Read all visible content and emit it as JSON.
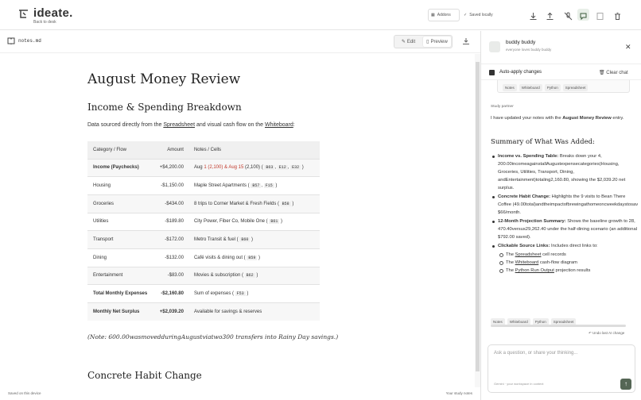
{
  "app": {
    "name": "ideate.",
    "back": "Back to desk"
  },
  "toolbar": {
    "addons": "Addons",
    "saved": "Saved locally"
  },
  "file": {
    "name": "notes.md",
    "edit": "Edit",
    "preview": "Preview"
  },
  "doc": {
    "title": "August Money Review",
    "h2a": "Income & Spending Breakdown",
    "p1a": "Data sourced directly from the ",
    "p1b": "Spreadsheet",
    "p1c": " and visual cash flow on the ",
    "p1d": "Whiteboard",
    "table": {
      "headers": [
        "Category / Flow",
        "Amount",
        "Notes / Cells"
      ],
      "rows": [
        {
          "cat": "Income (Paychecks)",
          "amt": "+$4,200.00",
          "note1": "Aug ",
          "note2": "1",
          "note3": " (2,100) & ",
          "note4": "Aug 15",
          "note5": " (2,100) ( ",
          "c1": "B63",
          "c2": "E12",
          "c3": "E32"
        },
        {
          "cat": "Housing",
          "amt": "-$1,150.00",
          "note": "Maple Street Apartments ( ",
          "c1": "B57",
          "c2": "F15"
        },
        {
          "cat": "Groceries",
          "amt": "-$434.00",
          "note": "8 trips to Corner Market & Fresh Fields ( ",
          "c1": "B58"
        },
        {
          "cat": "Utilities",
          "amt": "-$189.80",
          "note": "City Power, Fiber Co, Mobile One ( ",
          "c1": "B61"
        },
        {
          "cat": "Transport",
          "amt": "-$172.00",
          "note": "Metro Transit & fuel ( ",
          "c1": "B60"
        },
        {
          "cat": "Dining",
          "amt": "-$132.00",
          "note": "Café visits & dining out ( ",
          "c1": "B59"
        },
        {
          "cat": "Entertainment",
          "amt": "-$83.00",
          "note": "Movies & subscription ( ",
          "c1": "B62"
        },
        {
          "cat": "Total Monthly Expenses",
          "amt": "-$2,160.80",
          "note": "Sum of expenses ( ",
          "c1": "F53"
        },
        {
          "cat": "Monthly Net Surplus",
          "amt": "+$2,039.20",
          "note": "Available for savings & reserves"
        }
      ]
    },
    "note": "(Note: 600.00wasmovedduringAugustviatwo300 transfers into Rainy Day savings.)",
    "h2b": "Concrete Habit Change"
  },
  "status": {
    "left": "Saved on this device",
    "right": "Your study notes"
  },
  "panel": {
    "name": "buddy buddy",
    "tagline": "everyone loves buddy buddy",
    "auto": "Auto-apply changes",
    "clear": "Clear chat",
    "tags": [
      "Notes",
      "Whiteboard",
      "Python",
      "Spreadsheet"
    ],
    "partner": "Study partner",
    "msg1": "I have updated your notes with the ",
    "msg1b": "August Money Review",
    "msg1c": " entry.",
    "summary": "Summary of What Was Added:",
    "b1t": "Income vs. Spending Table:",
    "b1": " Breaks down your 4, 200.00incomeagainstallAugustexpensecategories(Housing, Groceries, Utilities, Transport, Dining, andEntertainment)totaling2,160.80, showing the $2,039.20 net surplus.",
    "b2t": "Concrete Habit Change:",
    "b2": " Highlights the 9 visits to Bean There Coffee (49.00total)andtheimpactofbrewingathomeoncweekdaystosav $66/month.",
    "b3t": "12-Month Projection Summary:",
    "b3": " Shows the baseline growth to 28, 470.40versus29,262.40 under the half-dining scenario (an additional $792.00 saved).",
    "b4t": "Clickable Source Links:",
    "b4": " Includes direct links to:",
    "s1a": "The ",
    "s1b": "Spreadsheet",
    "s1c": " cell records",
    "s2a": "The ",
    "s2b": "Whiteboard",
    "s2c": " cash-flow diagram",
    "s3a": "The ",
    "s3b": "Python Run Output",
    "s3c": " projection results",
    "undo": "Undo last AI change",
    "placeholder": "Ask a question, or share your thinking...",
    "context": "Gemini · your workspace in context"
  }
}
